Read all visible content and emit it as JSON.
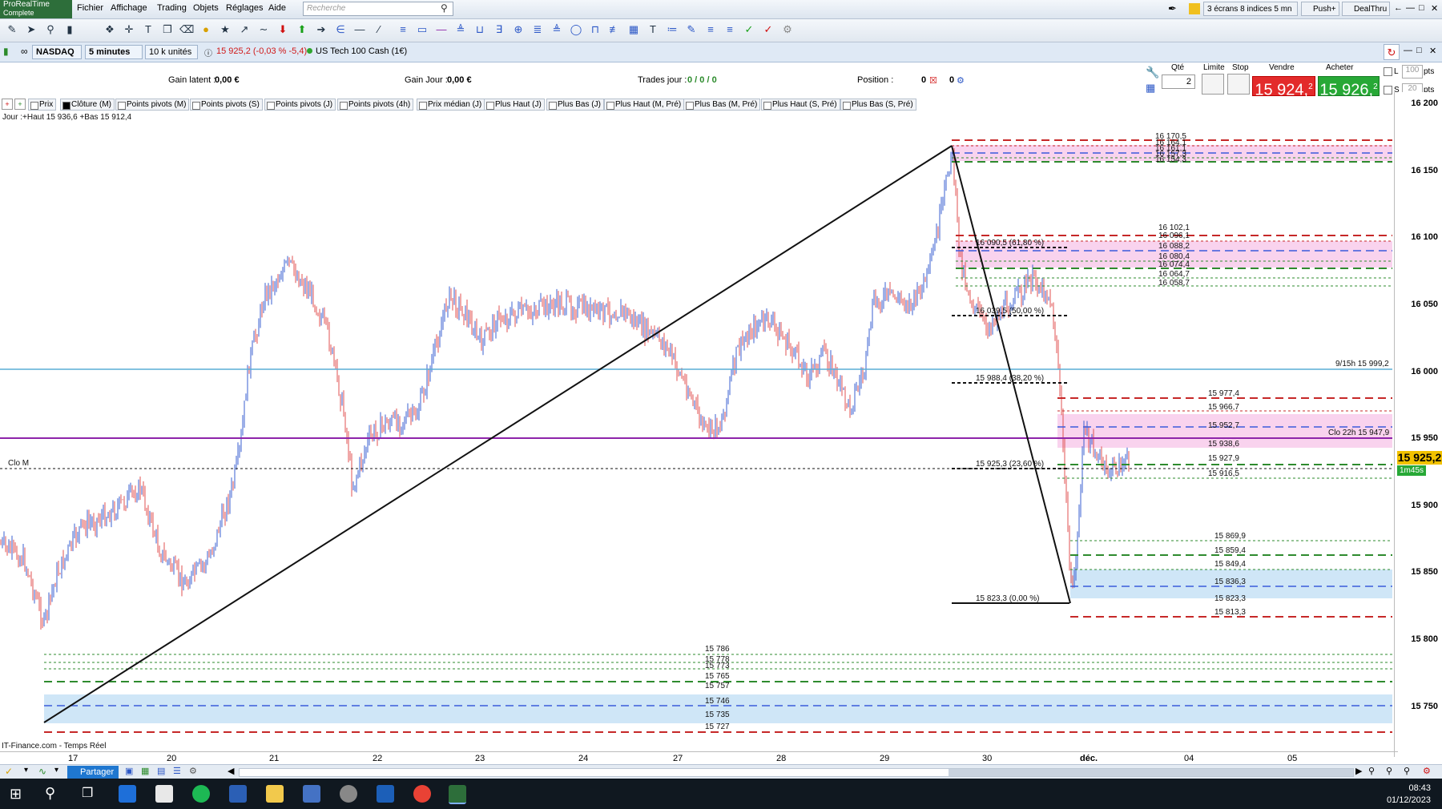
{
  "app": {
    "logo_line1": "ProRealTime",
    "logo_line2": "Complete"
  },
  "menu": [
    "Fichier",
    "Affichage",
    "Trading",
    "Objets",
    "Réglages",
    "Aide"
  ],
  "search": {
    "placeholder": "Recherche"
  },
  "top_right": {
    "layout": "3 écrans 8 indices 5 mn",
    "push": "Push+",
    "dealthru": "DealThru"
  },
  "instrument": {
    "market": "NASDAQ",
    "timeframe": "5 minutes",
    "units": "10 k unités",
    "price_change": "15 925,2 (-0,03 % -5,4)",
    "name": "US Tech 100 Cash (1€)"
  },
  "position_bar": {
    "gain_latent_label": "Gain latent :",
    "gain_latent_value": "0,00 €",
    "gain_jour_label": "Gain Jour :",
    "gain_jour_value": "0,00 €",
    "trades_label": "Trades jour :",
    "trades_value": "0 / 0 / 0",
    "position_label": "Position :",
    "position_value": "0",
    "position_value2": "0"
  },
  "order_panel": {
    "qty_label": "Qté",
    "qty_value": "2",
    "limit_label": "Limite",
    "stop_label": "Stop",
    "sell_label": "Vendre",
    "buy_label": "Acheter",
    "sell_price": "15 924,",
    "sell_sup": "2",
    "buy_price": "15 926,",
    "buy_sup": "2",
    "l_label": "L",
    "l_value": "100",
    "s_label": "S",
    "s_value": "20",
    "pts": "pts"
  },
  "indicators": [
    {
      "label": "Prix",
      "on": false
    },
    {
      "label": "Clôture (M)",
      "on": true
    },
    {
      "label": "Points pivots (M)",
      "on": false
    },
    {
      "label": "Points pivots (S)",
      "on": false
    },
    {
      "label": "Points pivots (J)",
      "on": false
    },
    {
      "label": "Points pivots (4h)",
      "on": false
    },
    {
      "label": "Prix médian (J)",
      "on": false
    },
    {
      "label": "Plus Haut (J)",
      "on": false
    },
    {
      "label": "Plus Bas (J)",
      "on": false
    },
    {
      "label": "Plus Haut (M, Pré)",
      "on": false
    },
    {
      "label": "Plus Bas (M, Pré)",
      "on": false
    },
    {
      "label": "Plus Haut (S, Pré)",
      "on": false
    },
    {
      "label": "Plus Bas (S, Pré)",
      "on": false
    }
  ],
  "chart": {
    "info": "Jour :+Haut 15 936,6 +Bas 15 912,4",
    "watermark": "IT-Finance.com - Temps Réel",
    "clo_m": "Clo M",
    "y_ticks": [
      "16 200",
      "16 150",
      "16 100",
      "16 050",
      "16 000",
      "15 950",
      "15 900",
      "15 850",
      "15 800",
      "15 750"
    ],
    "x_ticks": [
      "17",
      "20",
      "21",
      "22",
      "23",
      "24",
      "27",
      "28",
      "29",
      "30",
      "déc.",
      "04",
      "05"
    ],
    "current_price": "15 925,2",
    "countdown": "1m45s",
    "level_9_15": "9/15h 15 999,2",
    "level_clo_22": "Clo 22h 15 947,9",
    "fib_labels": [
      "16 090,5 (61,80 %)",
      "16 039,5 (50,00 %)",
      "15 988,4 (38,20 %)",
      "15 925,3 (23,60 %)",
      "15 823,3 (0,00 %)"
    ],
    "top_levels": [
      "16 170,5",
      "16 164,1",
      "16 161,1",
      "16 157,3",
      "16 154,3"
    ],
    "mid_levels": [
      "16 102,1",
      "16 096,1",
      "16 088,2",
      "16 080,4",
      "16 074,4",
      "16 064,7",
      "16 058,7"
    ],
    "right_levels": [
      "15 977,4",
      "15 966,7",
      "15 952,7",
      "15 938,6",
      "15 927,9",
      "15 916,5"
    ],
    "low_right_levels": [
      "15 869,9",
      "15 859,4",
      "15 849,4",
      "15 836,3",
      "15 823,3",
      "15 813,3"
    ],
    "bottom_levels": [
      "15 786",
      "15 778",
      "15 773",
      "15 765",
      "15 757",
      "15 746",
      "15 735",
      "15 727"
    ]
  },
  "bottom": {
    "share": "Partager"
  },
  "clock": {
    "time": "08:43",
    "date": "01/12/2023"
  },
  "colors": {
    "up": "#3a5fd0",
    "down": "#e05050",
    "red": "#c62828",
    "green": "#2e8b2e",
    "blue": "#3b5bdb",
    "pink": "#f9d3ee",
    "lightblue": "#cfe6f7",
    "purple": "#8e24aa",
    "cyan": "#5aaed6"
  }
}
